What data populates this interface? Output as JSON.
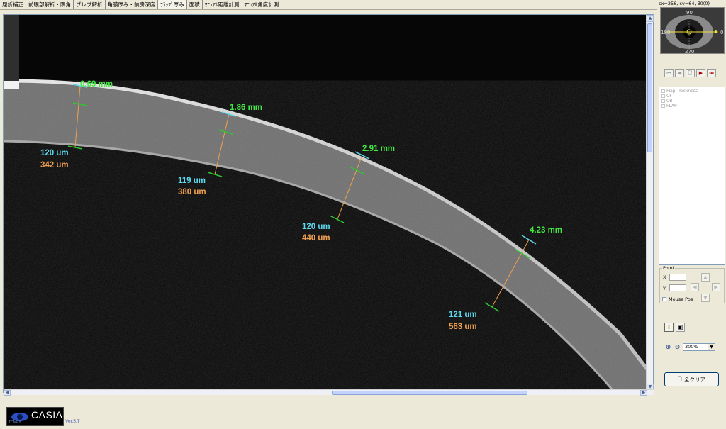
{
  "tabs": [
    {
      "label": "屈折補正",
      "active": false
    },
    {
      "label": "前眼部解析・隅角",
      "active": false
    },
    {
      "label": "ブレブ解析",
      "active": false
    },
    {
      "label": "角膜厚み・前房深度",
      "active": false
    },
    {
      "label": "ﾌﾗｯﾌﾟ厚み",
      "active": true
    },
    {
      "label": "面積",
      "active": false
    },
    {
      "label": "ﾏﾆｭｱﾙ距離計測",
      "active": false
    },
    {
      "label": "ﾏﾆｭｱﾙ角度計測",
      "active": false
    }
  ],
  "measurements": [
    {
      "position": "0.69 mm",
      "flap": "120 um",
      "total": "342 um"
    },
    {
      "position": "1.86 mm",
      "flap": "119 um",
      "total": "380 um"
    },
    {
      "position": "2.91 mm",
      "flap": "120 um",
      "total": "440 um"
    },
    {
      "position": "4.23 mm",
      "flap": "121 um",
      "total": "563 um"
    }
  ],
  "side": {
    "coord_text": "cx=256, cy=64, θ0(0)",
    "thumbnail": {
      "top": "90",
      "left": "180",
      "right": "0",
      "bottom": "270"
    },
    "list_items": [
      "Flap Thickness",
      "CF",
      "CB",
      "FLAP"
    ],
    "point": {
      "legend": "Point",
      "x_label": "X",
      "y_label": "Y",
      "mouse_pos_label": "Mouse Pos"
    },
    "zoom_value": "300%",
    "clear_label": "全クリア"
  },
  "footer": {
    "tomey": "TOMEY",
    "casia": "CASIA",
    "version": "Ver.5.T"
  },
  "colors": {
    "green": "#44e844",
    "cyan": "#5cd9ee",
    "orange": "#f0a050",
    "line_green": "#2ec82e"
  }
}
